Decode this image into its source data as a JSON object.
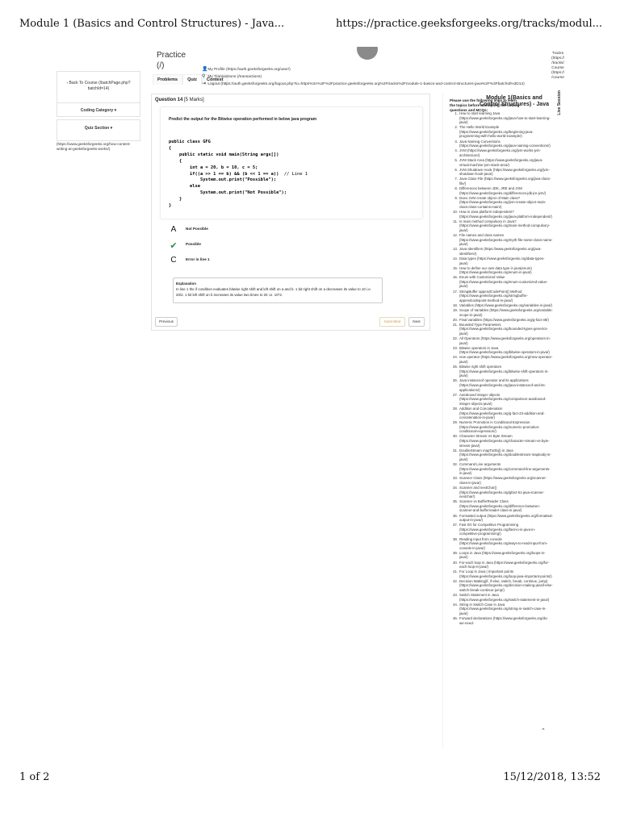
{
  "print": {
    "title": "Module 1 (Basics and Control Structures) - Java...",
    "url": "https://practice.geeksforgeeks.org/tracks/modul...",
    "page": "1 of 2",
    "datetime": "15/12/2018, 13:52"
  },
  "header": {
    "brand": "Practice",
    "brand_sub": "(/)",
    "tabs": [
      "Problems",
      "Quiz",
      "Contest"
    ],
    "usermenu": [
      {
        "icon": "user-icon",
        "label": "My Profile (https://auth.geeksforgeeks.org/user/)"
      },
      {
        "icon": "transactions-icon",
        "label": "My Transactions (/transactions)"
      },
      {
        "icon": "logout-icon",
        "label": "Logout (https://auth.geeksforgeeks.org/logout.php?to=https%3A%2F%2Fpractice.geeksforgeeks.org%2Ftracks%2Fmodule-1-basics-and-control-structures-java%2F%3FbatchId%3D14)"
      }
    ]
  },
  "left": {
    "back_label": "‹ Back To Course (/batchPage.php?batchId=14)",
    "coding_category": "Coding Category ▾",
    "quiz_section": "Quiz Section ▾",
    "link": "(https://www.geeksforgeeks.org/how-content-writing-at-geeksforgeeks-works/)"
  },
  "question": {
    "title": "Question 14",
    "marks": "[5 Marks]",
    "prompt": "Predict the output for the Bitwise operation performed in below java program",
    "code_lines": [
      "public class GFG",
      "{",
      "    public static void main(String args[])",
      "    {",
      "        int a = 20, b = 10, c = 5;",
      "        if((a >> 1 == b) && (b << 1 == a))",
      "            System.out.print(\"Possible\");",
      "        else",
      "            System.out.print(\"Not Possible\");",
      "    }",
      "}"
    ],
    "code_comment": "// Line 1",
    "options": [
      {
        "mark": "A",
        "text": "Not Possible",
        "correct": false
      },
      {
        "mark": "✔",
        "text": "Possible",
        "correct": true
      },
      {
        "mark": "C",
        "text": "Error in line 1",
        "correct": false
      }
    ],
    "explanation_heading": "Explanation",
    "explanation": "In line 1 the if condition evaluates bitwise right shift and left shift on a and b. 1 bit right shift on a decreases its value to 10 i.e. 20/2. 1 bit left shift on b increases its value two times to 20 i.e. 10*2.",
    "buttons": {
      "prev": "Previous",
      "submitted": "Submitted",
      "next": "Next"
    }
  },
  "right": {
    "title": "Module 1(Basics and Control Structures) - Java",
    "lead": "Please use the following links to learn the topics before attempting the coding questions and MCQs:",
    "tabs_text": "Tracks (https:// /tracks/ Course (https:// /course",
    "vertical": "Live Session",
    "items": [
      "How to start learning Java (https://www.geeksforgeeks.org/java-how-to-start-learning-java/)",
      "The Hello World Example (https://www.geeksforgeeks.org/beginning-java-programming-with-hello-world-example/)",
      "Java Naming Conventions (https://www.geeksforgeeks.org/java-naming-conventions/)",
      "JVM (https://www.geeksforgeeks.org/jvm-works-jvm-architecture/)",
      "JVM Stack Area (https://www.geeksforgeeks.org/java-virtual-machine-jvm-stack-area/)",
      "JVM Shutdown Hook (https://www.geeksforgeeks.org/jvm-shutdown-hook-java/)",
      "Java Class File (https://www.geeksforgeeks.org/java-class-file/)",
      "Differences between JDK, JRE and JVM (https://www.geeksforgeeks.org/differences-jdk-jre-jvm/)",
      "Does JVM create object of Main class? (https://www.geeksforgeeks.org/jvm-create-object-main-class-class-contains-main/)",
      "How is Java platform independent? (https://www.geeksforgeeks.org/java-platform-independent/)",
      "Is main method compulsory in Java? (https://www.geeksforgeeks.org/main-method-compulsory-java/)",
      "File names and class names (https://www.geeksforgeeks.org/myth-file-name-class-name-java/)",
      "Java Identifiers (https://www.geeksforgeeks.org/java-identifiers/)",
      "Data types (https://www.geeksforgeeks.org/data-types-java/)",
      "How to define our own data type in java(enum) (https://www.geeksforgeeks.org/enum-in-java/)",
      "Enum with Customized Value (https://www.geeksforgeeks.org/enum-customized-value-java/)",
      "StringBuffer appendCodePoint() Method (https://www.geeksforgeeks.org/stringbuffer-appendcodepoint-method-in-java/)",
      "Variables (https://www.geeksforgeeks.org/variables-in-java/)",
      "Scope of Variables (https://www.geeksforgeeks.org/variable-scope-in-java/)",
      "Final variables (https://www.geeksforgeeks.org/g-fact-48/)",
      "Bounded Type Parameters (https://www.geeksforgeeks.org/bounded-types-generics-java/)",
      "All Operators (https://www.geeksforgeeks.org/operators-in-java/)",
      "Bitwise operators in Java (https://www.geeksforgeeks.org/bitwise-operators-in-java/)",
      "new operator (https://www.geeksforgeeks.org/new-operator-java/)",
      "Bitwise right shift operators (https://www.geeksforgeeks.org/bitwise-shift-operators-in-java/)",
      "Java instanceof operator and its applications (https://www.geeksforgeeks.org/java-instanceof-and-its-applications/)",
      "Autoboxed integer objects (https://www.geeksforgeeks.org/comparison-autoboxed-integer-objects-java/)",
      "Addition and Concatenation (https://www.geeksforgeeks.org/g-fact-23-addition-and-concatenation-in-java/)",
      "Numeric Promotion in Conditional Expression (https://www.geeksforgeeks.org/numeric-promotion-conditional-expression/)",
      "Character Stream Vs Byte Stream (https://www.geeksforgeeks.org/character-stream-vs-byte-stream-java/)",
      "DoubleStream mapToObj() in Java (https://www.geeksforgeeks.org/doublestream-maptoobj-in-java/)",
      "Command Line arguments (https://www.geeksforgeeks.org/command-line-arguments-in-java/)",
      "Scanner Class (https://www.geeksforgeeks.org/scanner-class-in-java/)",
      "Scanner and nextChar() (https://www.geeksforgeeks.org/gfact-51-java-scanner-nextchar/)",
      "Scanner vs BufferReader Class (https://www.geeksforgeeks.org/difference-between-scanner-and-bufferreader-class-in-java/)",
      "Formatted output (https://www.geeksforgeeks.org/formatted-output-in-java/)",
      "Fast I/O for Competitive Programming (https://www.geeksforgeeks.org/fast-io-in-java-in-competitive-programming/)",
      "Reading input from console (https://www.geeksforgeeks.org/ways-to-read-input-from-console-in-java/)",
      "Loops in Java (https://www.geeksforgeeks.org/loops-in-java/)",
      "For-each loop in Java (https://www.geeksforgeeks.org/for-each-loop-in-java/)",
      "For Loop in Java | Important points (https://www.geeksforgeeks.org/loop-java-important-points/)",
      "Decision Making(if, if-else, switch, break, continue, jump) (https://www.geeksforgeeks.org/decision-making-javaif-else-switch-break-continue-jump/)",
      "Switch Statement in Java (https://www.geeksforgeeks.org/switch-statement-in-java/)",
      "String in Switch Case in Java (https://www.geeksforgeeks.org/string-in-switch-case-in-java/)",
      "Forward declarations (https://www.geeksforgeeks.org/do-we-need-"
    ],
    "scroll_top": "⌃"
  }
}
